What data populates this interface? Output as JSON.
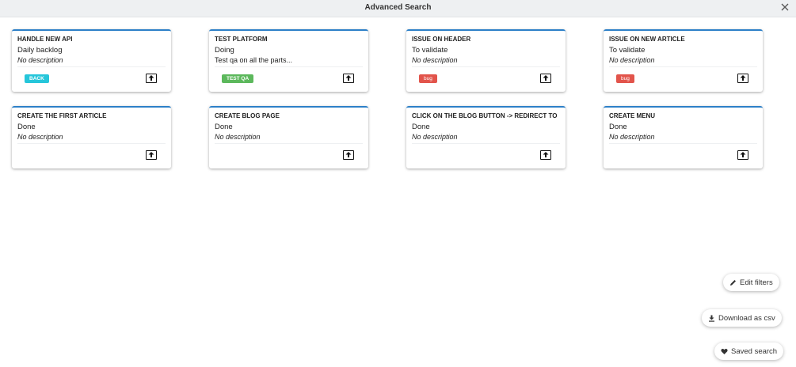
{
  "header": {
    "title": "Advanced Search",
    "close_icon": "close-icon"
  },
  "cards": [
    {
      "name": "HANDLE NEW API",
      "status": "Daily backlog",
      "description": "No description",
      "tag": "BACK",
      "tag_color": "#26c6da"
    },
    {
      "name": "TEST PLATFORM",
      "status": "Doing",
      "description": "Test qa on all the parts...",
      "tag": "TEST QA",
      "tag_color": "#5cb85c"
    },
    {
      "name": "ISSUE ON HEADER",
      "status": "To validate",
      "description": "No description",
      "tag": "bug",
      "tag_color": "#e2544b"
    },
    {
      "name": "ISSUE ON NEW ARTICLE",
      "status": "To validate",
      "description": "No description",
      "tag": "bug",
      "tag_color": "#e2544b"
    },
    {
      "name": "CREATE THE FIRST ARTICLE",
      "status": "Done",
      "description": "No description"
    },
    {
      "name": "CREATE BLOG PAGE",
      "status": "Done",
      "description": "No description"
    },
    {
      "name": "CLICK ON THE BLOG BUTTON -> REDIRECT TO",
      "status": "Done",
      "description": "No description"
    },
    {
      "name": "CREATE MENU",
      "status": "Done",
      "description": "No description"
    }
  ],
  "actions": {
    "edit_filters": "Edit filters",
    "download_csv": "Download as csv",
    "saved_search": "Saved search"
  },
  "colors": {
    "card_accent": "#2d80c8",
    "topbar_bg": "#eef0f2"
  }
}
